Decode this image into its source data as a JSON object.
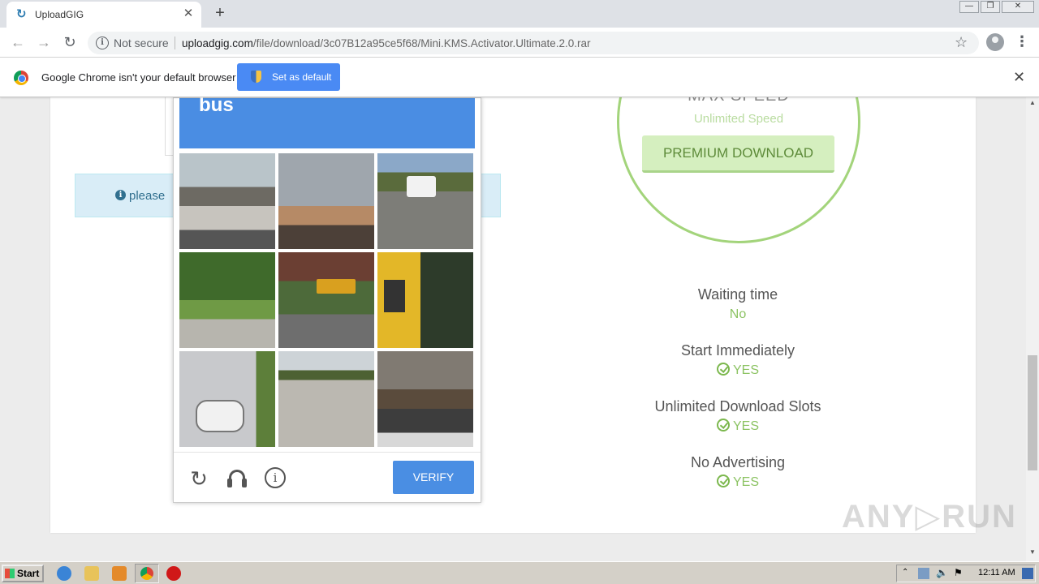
{
  "browser": {
    "tab_title": "UploadGIG",
    "tab_favicon": "↻",
    "not_secure": "Not secure",
    "url_host": "uploadgig.com",
    "url_path": "/file/download/3c07B12a95ce5f68/Mini.KMS.Activator.Ultimate.2.0.rar"
  },
  "infobar": {
    "message": "Google Chrome isn't your default browser",
    "button_label": "Set as default"
  },
  "page": {
    "notice_text": "please",
    "premium": {
      "max_speed": "MAX SPEED",
      "unlimited_speed": "Unlimited Speed",
      "button_label": "PREMIUM DOWNLOAD"
    },
    "features": [
      {
        "title": "Waiting time",
        "value": "No",
        "check": false
      },
      {
        "title": "Start Immediately",
        "value": "YES",
        "check": true
      },
      {
        "title": "Unlimited Download Slots",
        "value": "YES",
        "check": true
      },
      {
        "title": "No Advertising",
        "value": "YES",
        "check": true
      }
    ]
  },
  "captcha": {
    "target": "bus",
    "verify_label": "VERIFY",
    "tiles": [
      {
        "label": "traffic-street"
      },
      {
        "label": "power-lines-sunset"
      },
      {
        "label": "white-bus-road"
      },
      {
        "label": "tree-sidewalk"
      },
      {
        "label": "school-bus-field"
      },
      {
        "label": "school-bus-closeup"
      },
      {
        "label": "scooter-wall"
      },
      {
        "label": "highway"
      },
      {
        "label": "motorcycle-street"
      }
    ]
  },
  "watermark": "ANY▷RUN",
  "taskbar": {
    "start_label": "Start",
    "clock": "12:11 AM"
  },
  "colors": {
    "captcha_blue": "#4a8de3",
    "premium_green": "#a3d47b",
    "yes_green": "#8cc363"
  }
}
